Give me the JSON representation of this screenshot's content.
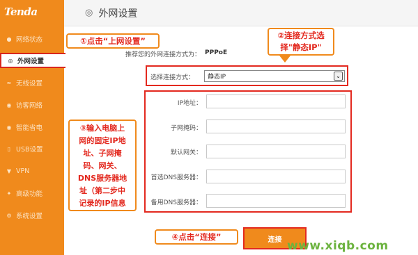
{
  "brand": {
    "logo_text": "Tenda"
  },
  "sidebar": {
    "items": [
      {
        "label": "网络状态",
        "icon": "user-icon",
        "active": false
      },
      {
        "label": "外网设置",
        "icon": "globe-icon",
        "active": true
      },
      {
        "label": "无线设置",
        "icon": "wifi-icon",
        "active": false
      },
      {
        "label": "访客网络",
        "icon": "guest-icon",
        "active": false
      },
      {
        "label": "智能省电",
        "icon": "bulb-icon",
        "active": false
      },
      {
        "label": "USB设置",
        "icon": "usb-icon",
        "active": false
      },
      {
        "label": "VPN",
        "icon": "vpn-icon",
        "active": false
      },
      {
        "label": "高级功能",
        "icon": "tool-icon",
        "active": false
      },
      {
        "label": "系统设置",
        "icon": "gear-icon",
        "active": false
      }
    ]
  },
  "header": {
    "title": "外网设置"
  },
  "form": {
    "recommend_label": "推荐您的外网连接方式为：",
    "recommend_value": "PPPoE",
    "connection_label": "选择连接方式：",
    "connection_value": "静态IP",
    "ip_label": "IP地址：",
    "mask_label": "子网掩码：",
    "gateway_label": "默认网关：",
    "dns1_label": "首选DNS服务器：",
    "dns2_label": "备用DNS服务器：",
    "connect_label": "连接"
  },
  "annotations": {
    "step1": "①点击“上网设置”",
    "step2_line1": "②连接方式选",
    "step2_line2": "择\"静态IP\"",
    "step3_lines": [
      "③输入电脑上",
      "网的固定IP地",
      "址、子网掩",
      "码、网关、",
      "DNS服务器地",
      "址（第二步中",
      "记录的IP信息"
    ],
    "step4": "④点击“连接”"
  },
  "watermark": "www.xiqb.com",
  "colors": {
    "accent": "#f08a1c",
    "highlight": "#e3291f",
    "watermark": "#6cb33f"
  }
}
